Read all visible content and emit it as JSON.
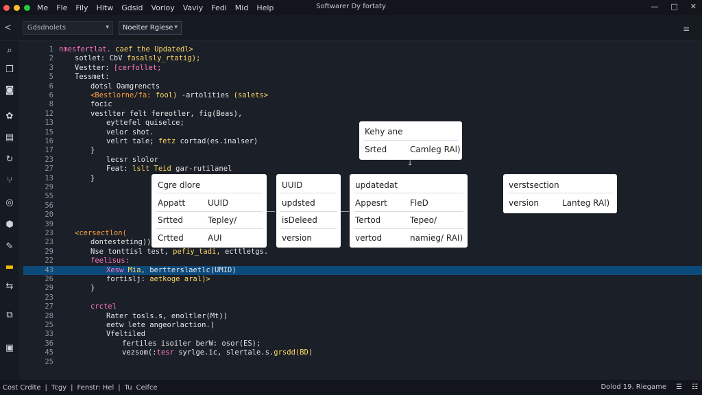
{
  "window": {
    "title": "Softwarer Dy fortaty",
    "menus": [
      "Me",
      "Fle",
      "Fily",
      "Hitw",
      "Gdsid",
      "Vorioy",
      "Vaviy",
      "Fedi",
      "Mid",
      "Help"
    ],
    "controls": [
      "—",
      "□",
      "✕"
    ],
    "traffic_colors": [
      "#ff5f57",
      "#febc2e",
      "#28c840"
    ]
  },
  "toolbar": {
    "back_label": "<",
    "select1_value": "Gdsdnolets",
    "select2_value": "Noeiter Rgiese",
    "caret": "▾",
    "right_icon": "≡"
  },
  "activity_icons": [
    {
      "name": "search-icon",
      "glyph": "⌕",
      "color": "#d0d6de"
    },
    {
      "name": "file-icon",
      "glyph": "❒",
      "color": "#d0d6de"
    },
    {
      "name": "shield-icon",
      "glyph": "◙",
      "color": "#d0d6de"
    },
    {
      "name": "settings-icon",
      "glyph": "✿",
      "color": "#d0d6de"
    },
    {
      "name": "image-icon",
      "glyph": "▤",
      "color": "#d0d6de"
    },
    {
      "name": "sync-icon",
      "glyph": "↻",
      "color": "#d0d6de"
    },
    {
      "name": "branch-icon",
      "glyph": "⑂",
      "color": "#d0d6de"
    },
    {
      "name": "chat-icon",
      "glyph": "◎",
      "color": "#d0d6de"
    },
    {
      "name": "badge-icon",
      "glyph": "⬢",
      "color": "#d0d6de"
    },
    {
      "name": "edit-icon",
      "glyph": "✎",
      "color": "#d0d6de"
    },
    {
      "name": "folder-icon",
      "glyph": "▬",
      "color": "#f2b705"
    },
    {
      "name": "split-icon",
      "glyph": "⇆",
      "color": "#d0d6de"
    },
    {
      "name": "copy-icon",
      "glyph": "⧉",
      "color": "#d0d6de"
    },
    {
      "name": "terminal-icon",
      "glyph": "▣",
      "color": "#d0d6de"
    }
  ],
  "code_lines": [
    {
      "n": "1",
      "indent": 0,
      "parts": [
        [
          "nmesfertlat.",
          "#ff79c6"
        ],
        [
          " caef ",
          "#ffd866"
        ],
        [
          "the Updatedl>",
          "#ffd866"
        ]
      ]
    },
    {
      "n": "2",
      "indent": 2,
      "parts": [
        [
          "sotlet: ",
          "#e6e6e6"
        ],
        [
          "CbV ",
          "#e6e6e6"
        ],
        [
          "fasalsly_rtatig);",
          "#ffd866"
        ]
      ]
    },
    {
      "n": "3",
      "indent": 2,
      "parts": [
        [
          "Vestter: ",
          "#e6e6e6"
        ],
        [
          "[cerfollet;",
          "#ff79c6"
        ]
      ]
    },
    {
      "n": "5",
      "indent": 2,
      "parts": [
        [
          "Tessmet:",
          "#e6e6e6"
        ]
      ]
    },
    {
      "n": "6",
      "indent": 4,
      "parts": [
        [
          "dotsl Oamgrencts",
          "#e6e6e6"
        ]
      ]
    },
    {
      "n": "6",
      "indent": 4,
      "parts": [
        [
          "<Bestlorne/fa: ",
          "#ff9f43"
        ],
        [
          "fool) ",
          "#ffd866"
        ],
        [
          "-artolities ",
          "#e6e6e6"
        ],
        [
          "(salets>",
          "#ffd866"
        ]
      ]
    },
    {
      "n": "8",
      "indent": 4,
      "parts": [
        [
          "focic",
          "#e6e6e6"
        ]
      ]
    },
    {
      "n": "12",
      "indent": 4,
      "parts": [
        [
          "vestlter ",
          "#e6e6e6"
        ],
        [
          "felt fereotler, ",
          "#e6e6e6"
        ],
        [
          "fig(Beas),",
          "#e6e6e6"
        ]
      ]
    },
    {
      "n": "13",
      "indent": 6,
      "parts": [
        [
          "eyttefel quiselce;",
          "#e6e6e6"
        ]
      ]
    },
    {
      "n": "15",
      "indent": 6,
      "parts": [
        [
          "velor shot.",
          "#e6e6e6"
        ]
      ]
    },
    {
      "n": "16",
      "indent": 6,
      "parts": [
        [
          "velrt tale; ",
          "#e6e6e6"
        ],
        [
          "fetz ",
          "#ffd866"
        ],
        [
          "cortad(es.inalser)",
          "#e6e6e6"
        ]
      ]
    },
    {
      "n": "17",
      "indent": 4,
      "parts": [
        [
          "}",
          "#e6e6e6"
        ]
      ]
    },
    {
      "n": "23",
      "indent": 6,
      "parts": [
        [
          "lecsr slolor",
          "#e6e6e6"
        ]
      ]
    },
    {
      "n": "27",
      "indent": 6,
      "parts": [
        [
          "Feat: ",
          "#e6e6e6"
        ],
        [
          "lslt Teid ",
          "#ffd866"
        ],
        [
          "gar-rutilanel",
          "#e6e6e6"
        ]
      ]
    },
    {
      "n": "13",
      "indent": 4,
      "parts": [
        [
          "}",
          "#e6e6e6"
        ]
      ]
    },
    {
      "n": "29",
      "indent": 0,
      "parts": []
    },
    {
      "n": "55",
      "indent": 0,
      "parts": []
    },
    {
      "n": "56",
      "indent": 0,
      "parts": []
    },
    {
      "n": "20",
      "indent": 0,
      "parts": []
    },
    {
      "n": "39",
      "indent": 0,
      "parts": []
    },
    {
      "n": "23",
      "indent": 2,
      "parts": [
        [
          "<cersectlon(",
          "#ff9f43"
        ]
      ]
    },
    {
      "n": "23",
      "indent": 4,
      "parts": [
        [
          "dontesteting))>",
          "#e6e6e6"
        ]
      ]
    },
    {
      "n": "29",
      "indent": 4,
      "parts": [
        [
          "Nse ",
          "#e6e6e6"
        ],
        [
          "tonttisl test, ",
          "#e6e6e6"
        ],
        [
          "pefiy_tadi, ",
          "#ffd866"
        ],
        [
          "ecttletgs.",
          "#e6e6e6"
        ]
      ]
    },
    {
      "n": "22",
      "indent": 4,
      "parts": [
        [
          "feelisus:",
          "#ff79c6"
        ]
      ]
    },
    {
      "n": "43",
      "indent": 6,
      "parts": [
        [
          "Xesw ",
          "#ff79c6"
        ],
        [
          "Mia, ",
          "#ffd866"
        ],
        [
          "bertterslaetlc(UMID)",
          "#e6e6e6"
        ]
      ],
      "highlight": true
    },
    {
      "n": "26",
      "indent": 6,
      "parts": [
        [
          "fortislj: ",
          "#e6e6e6"
        ],
        [
          "aetkoge aral)>",
          "#ffd866"
        ]
      ]
    },
    {
      "n": "29",
      "indent": 4,
      "parts": [
        [
          "}",
          "#e6e6e6"
        ]
      ]
    },
    {
      "n": "23",
      "indent": 0,
      "parts": []
    },
    {
      "n": "27",
      "indent": 4,
      "parts": [
        [
          "crctel",
          "#ff79c6"
        ]
      ]
    },
    {
      "n": "28",
      "indent": 6,
      "parts": [
        [
          "Rater ",
          "#e6e6e6"
        ],
        [
          "tosls.s, ",
          "#e6e6e6"
        ],
        [
          "enoltler(Mt))",
          "#e6e6e6"
        ]
      ]
    },
    {
      "n": "25",
      "indent": 6,
      "parts": [
        [
          "eetw lete ",
          "#e6e6e6"
        ],
        [
          "angeorlaction.)",
          "#e6e6e6"
        ]
      ]
    },
    {
      "n": "33",
      "indent": 6,
      "parts": [
        [
          "Vfeltiled",
          "#e6e6e6"
        ]
      ]
    },
    {
      "n": "36",
      "indent": 8,
      "parts": [
        [
          "fertiles ",
          "#e6e6e6"
        ],
        [
          "isoiler ",
          "#e6e6e6"
        ],
        [
          "berW: ",
          "#e6e6e6"
        ],
        [
          "osor(ES);",
          "#e6e6e6"
        ]
      ]
    },
    {
      "n": "45",
      "indent": 8,
      "parts": [
        [
          "vezsom(:",
          "#e6e6e6"
        ],
        [
          "tesr ",
          "#ff79c6"
        ],
        [
          "syrlge.ic, ",
          "#e6e6e6"
        ],
        [
          "slertale.s.",
          "#e6e6e6"
        ],
        [
          "grsdd(BD)",
          "#ffd866"
        ]
      ]
    },
    {
      "n": "25",
      "indent": 0,
      "parts": []
    }
  ],
  "cards": {
    "key_name": {
      "title": "Kehy ane",
      "rows": [
        [
          "Srted",
          "Camleg RAl)"
        ]
      ]
    },
    "core": {
      "title": "Cgre dlore",
      "rows": [
        [
          "Appatt",
          "UUID"
        ],
        [
          "Srtted",
          "Tepley/"
        ],
        [
          "Crtted",
          "AUI"
        ]
      ]
    },
    "uuid": {
      "title": "UUID",
      "rows": [
        [
          "updsted"
        ],
        [
          "isDeleed"
        ],
        [
          "version"
        ]
      ]
    },
    "updated": {
      "title": "updatedat",
      "rows": [
        [
          "Appesrt",
          "FleD"
        ],
        [
          "Tertod",
          "Tepeo/"
        ],
        [
          "vertod",
          "namieg/ RAI)"
        ]
      ]
    },
    "versection": {
      "title": "verstsection",
      "rows": [
        [
          "version",
          "Lanteg RAl)"
        ]
      ]
    }
  },
  "statusbar": {
    "left": [
      "Cost Crdite",
      "Tcgy",
      "Fenstr: Hel",
      "Tu",
      "Ceifce"
    ],
    "separators": [
      "|",
      "|",
      "|"
    ],
    "right": [
      "Dolod 19. Riegame",
      "☰",
      "☷"
    ]
  }
}
